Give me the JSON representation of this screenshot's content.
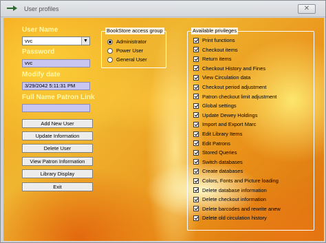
{
  "window": {
    "title": "User profiles",
    "close_glyph": "✕"
  },
  "form": {
    "user_name_label": "User Name",
    "user_name_value": "vvc",
    "password_label": "Password",
    "password_value": "vvc",
    "modify_date_label": "Modify date",
    "modify_date_value": "3/29/2042 5:11:31 PM",
    "patron_link_label": "Full Name Patron Link",
    "patron_link_value": ""
  },
  "buttons": {
    "add_new_user": "Add New User",
    "update_information": "Update Information",
    "delete_user": "Delete User",
    "view_patron_information": "View Patron Information",
    "library_display": "Library Display",
    "exit": "Exit"
  },
  "access_group": {
    "title": "BookStore access group",
    "options": [
      "Administrator",
      "Power User",
      "General User"
    ],
    "selected": "Administrator"
  },
  "privileges": {
    "title": "Available privileges",
    "items": [
      {
        "label": "Print functions",
        "checked": true
      },
      {
        "label": "Checkout items",
        "checked": true
      },
      {
        "label": "Return items",
        "checked": true
      },
      {
        "label": "Checkout History and Fines",
        "checked": true
      },
      {
        "label": "View Circulation data",
        "checked": true
      },
      {
        "label": "Checkout period adjustment",
        "checked": true
      },
      {
        "label": "Patron checkout limit adjustment",
        "checked": true
      },
      {
        "label": "Global settings",
        "checked": true
      },
      {
        "label": "Update Dewey Holdings",
        "checked": true
      },
      {
        "label": "Import and Export Marc",
        "checked": true
      },
      {
        "label": "Edit Library Items",
        "checked": true
      },
      {
        "label": "Edit Patrons",
        "checked": true
      },
      {
        "label": "Stored Queries",
        "checked": true
      },
      {
        "label": "Switch databases",
        "checked": true
      },
      {
        "label": "Create databases",
        "checked": true
      },
      {
        "label": "Colors, Fonts and Picture loading",
        "checked": true
      },
      {
        "label": "Delete database information",
        "checked": true
      },
      {
        "label": "Delete checkout information",
        "checked": true
      },
      {
        "label": "Delete barcodes and rewrite anew",
        "checked": true
      },
      {
        "label": "Delete old circulation history",
        "checked": true
      }
    ]
  },
  "colors": {
    "label_yellow": "#fff8a8",
    "field_lavender": "#c9c6f2",
    "background_orange": "#f0a020"
  }
}
